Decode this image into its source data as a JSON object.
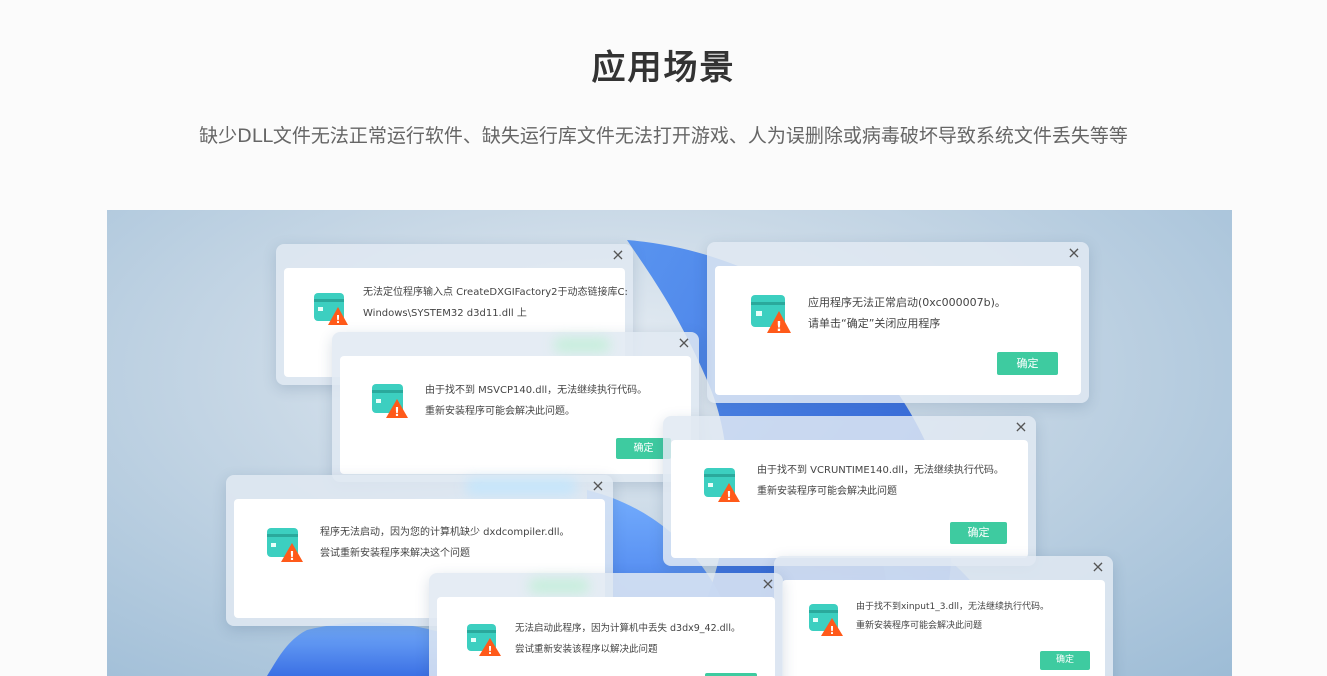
{
  "header": {
    "title": "应用场景",
    "subtitle": "缺少DLL文件无法正常运行软件、缺失运行库文件无法打开游戏、人为误删除或病毒破坏导致系统文件丢失等等"
  },
  "colors": {
    "accent": "#3ecba0",
    "warning": "#ff5a1a",
    "icon_teal": "#3ccfc0"
  },
  "dialogs": [
    {
      "id": "d1",
      "lines": [
        "无法定位程序输入点 CreateDXGIFactory2于动态链接库C:",
        "Windows\\SYSTEM32 d3d11.dll 上"
      ]
    },
    {
      "id": "d2",
      "lines": [
        "应用程序无法正常启动(0xc000007b)。",
        "请单击“确定”关闭应用程序"
      ],
      "ok": "确定"
    },
    {
      "id": "d3",
      "lines": [
        "由于找不到 MSVCP140.dll，无法继续执行代码。",
        "重新安装程序可能会解决此问题。"
      ],
      "ok": "确定"
    },
    {
      "id": "d4",
      "lines": [
        "由于找不到 VCRUNTIME140.dll，无法继续执行代码。",
        "重新安装程序可能会解决此问题"
      ],
      "ok": "确定"
    },
    {
      "id": "d5",
      "lines": [
        "程序无法启动，因为您的计算机缺少 dxdcompiler.dll。",
        "尝试重新安装程序来解决这个问题"
      ]
    },
    {
      "id": "d6",
      "lines": [
        "无法启动此程序，因为计算机中丢失 d3dx9_42.dll。",
        "尝试重新安装该程序以解决此问题"
      ]
    },
    {
      "id": "d7",
      "lines": [
        "由于找不到xinput1_3.dll，无法继续执行代码。",
        "重新安装程序可能会解决此问题"
      ],
      "ok": "确定"
    }
  ]
}
